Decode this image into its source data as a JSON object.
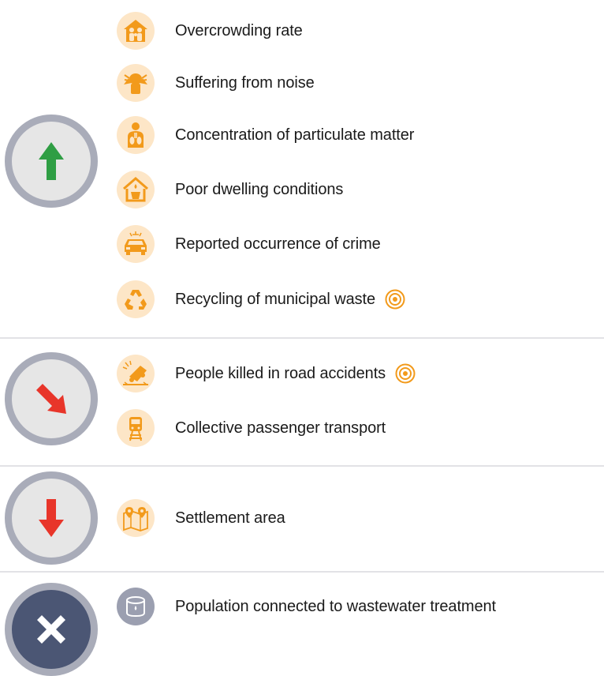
{
  "groups": [
    {
      "status": "on-track",
      "status_icon": "arrow-up-icon",
      "status_color": "#2f9e44",
      "items": [
        {
          "label": "Overcrowding rate",
          "icon": "house-family-icon",
          "target": false
        },
        {
          "label": "Suffering from noise",
          "icon": "noise-icon",
          "target": false
        },
        {
          "label": "Concentration of particulate matter",
          "icon": "lungs-icon",
          "target": false
        },
        {
          "label": "Poor dwelling conditions",
          "icon": "leaking-house-icon",
          "target": false
        },
        {
          "label": "Reported occurrence of crime",
          "icon": "police-car-icon",
          "target": false
        },
        {
          "label": "Recycling of municipal waste",
          "icon": "recycle-icon",
          "target": true
        }
      ]
    },
    {
      "status": "moderate",
      "status_icon": "arrow-down-right-icon",
      "status_color": "#e8352a",
      "items": [
        {
          "label": "People killed in road accidents",
          "icon": "car-crash-icon",
          "target": true
        },
        {
          "label": "Collective passenger transport",
          "icon": "train-icon",
          "target": false
        }
      ]
    },
    {
      "status": "away",
      "status_icon": "arrow-down-icon",
      "status_color": "#e8352a",
      "items": [
        {
          "label": "Settlement area",
          "icon": "map-pins-icon",
          "target": false
        }
      ]
    },
    {
      "status": "not-assessable",
      "status_icon": "cross-icon",
      "status_color": "#4b5674",
      "items": [
        {
          "label": "Population connected to wastewater treatment",
          "icon": "water-tank-icon",
          "target": false
        }
      ]
    }
  ],
  "colors": {
    "icon_orange": "#f29a1b",
    "icon_bg": "#fde6c7",
    "target_orange": "#f29a1b",
    "divider": "#e2e2e6",
    "circle_ring": "#a9acb9",
    "circle_fill": "#e6e6e6"
  }
}
